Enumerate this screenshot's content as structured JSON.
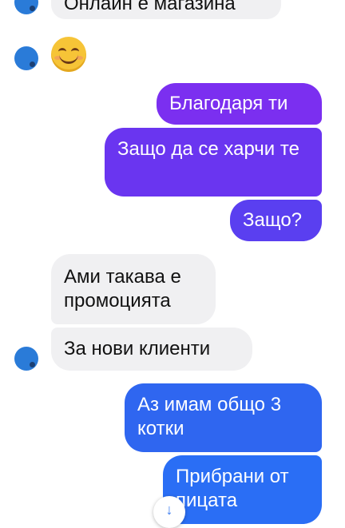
{
  "messages": [
    {
      "text": "Онлайн е магазина",
      "direction": "incoming"
    },
    {
      "text": "😊",
      "direction": "incoming",
      "type": "emoji"
    },
    {
      "text": "Благодаря ти",
      "direction": "outgoing",
      "color": "#7b2ff0"
    },
    {
      "text": "Защо да се харчи те",
      "direction": "outgoing",
      "color": "#6a35f0"
    },
    {
      "text": "Защо?",
      "direction": "outgoing",
      "color": "#5a3ff0"
    },
    {
      "text": "Ами такава е промоцията",
      "direction": "incoming"
    },
    {
      "text": "За нови клиенти",
      "direction": "incoming"
    },
    {
      "text": "Аз имам общо 3 котки",
      "direction": "outgoing",
      "color": "#2f66f0"
    },
    {
      "text": "Прибрани от пицата",
      "direction": "outgoing",
      "color": "#2a6ef5"
    }
  ],
  "colors": {
    "incoming_bg": "#f0f0f2",
    "avatar": "#2a7bd8"
  },
  "icons": {
    "scroll_down": "arrow-down-icon"
  }
}
